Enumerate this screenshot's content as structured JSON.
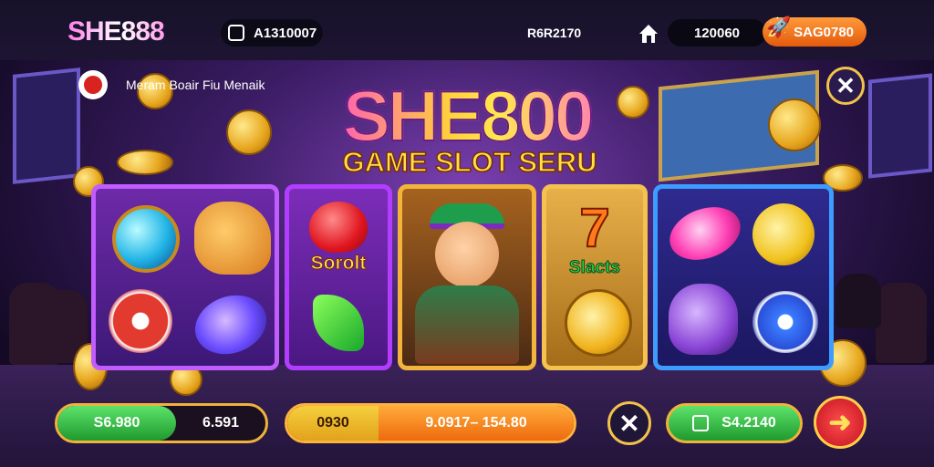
{
  "header": {
    "logo": "SHE888",
    "player_id": "A1310007",
    "center_code": "R6R2170",
    "balance": "120060",
    "bonus": "SAG0780"
  },
  "notice": {
    "text": "Meram Boair Fiu Menaik"
  },
  "title": {
    "main": "SHE800",
    "sub": "GAME SLOT SERU"
  },
  "reels": {
    "label_r2": "Sorolt",
    "label_r4_seven": "7",
    "label_r4": "Slacts"
  },
  "footer": {
    "bet_green": "S6.980",
    "bet_value": "6.591",
    "line_left": "0930",
    "line_right": "9.0917– 154.80",
    "win": "S4.2140"
  },
  "icons": [
    "id-card-icon",
    "home-icon",
    "rocket-icon",
    "close-icon",
    "spin-arrow-icon",
    "wallet-icon"
  ],
  "colors": {
    "accent_gold": "#f2c24a",
    "green": "#1f9a2e",
    "orange": "#ee6a0e"
  }
}
